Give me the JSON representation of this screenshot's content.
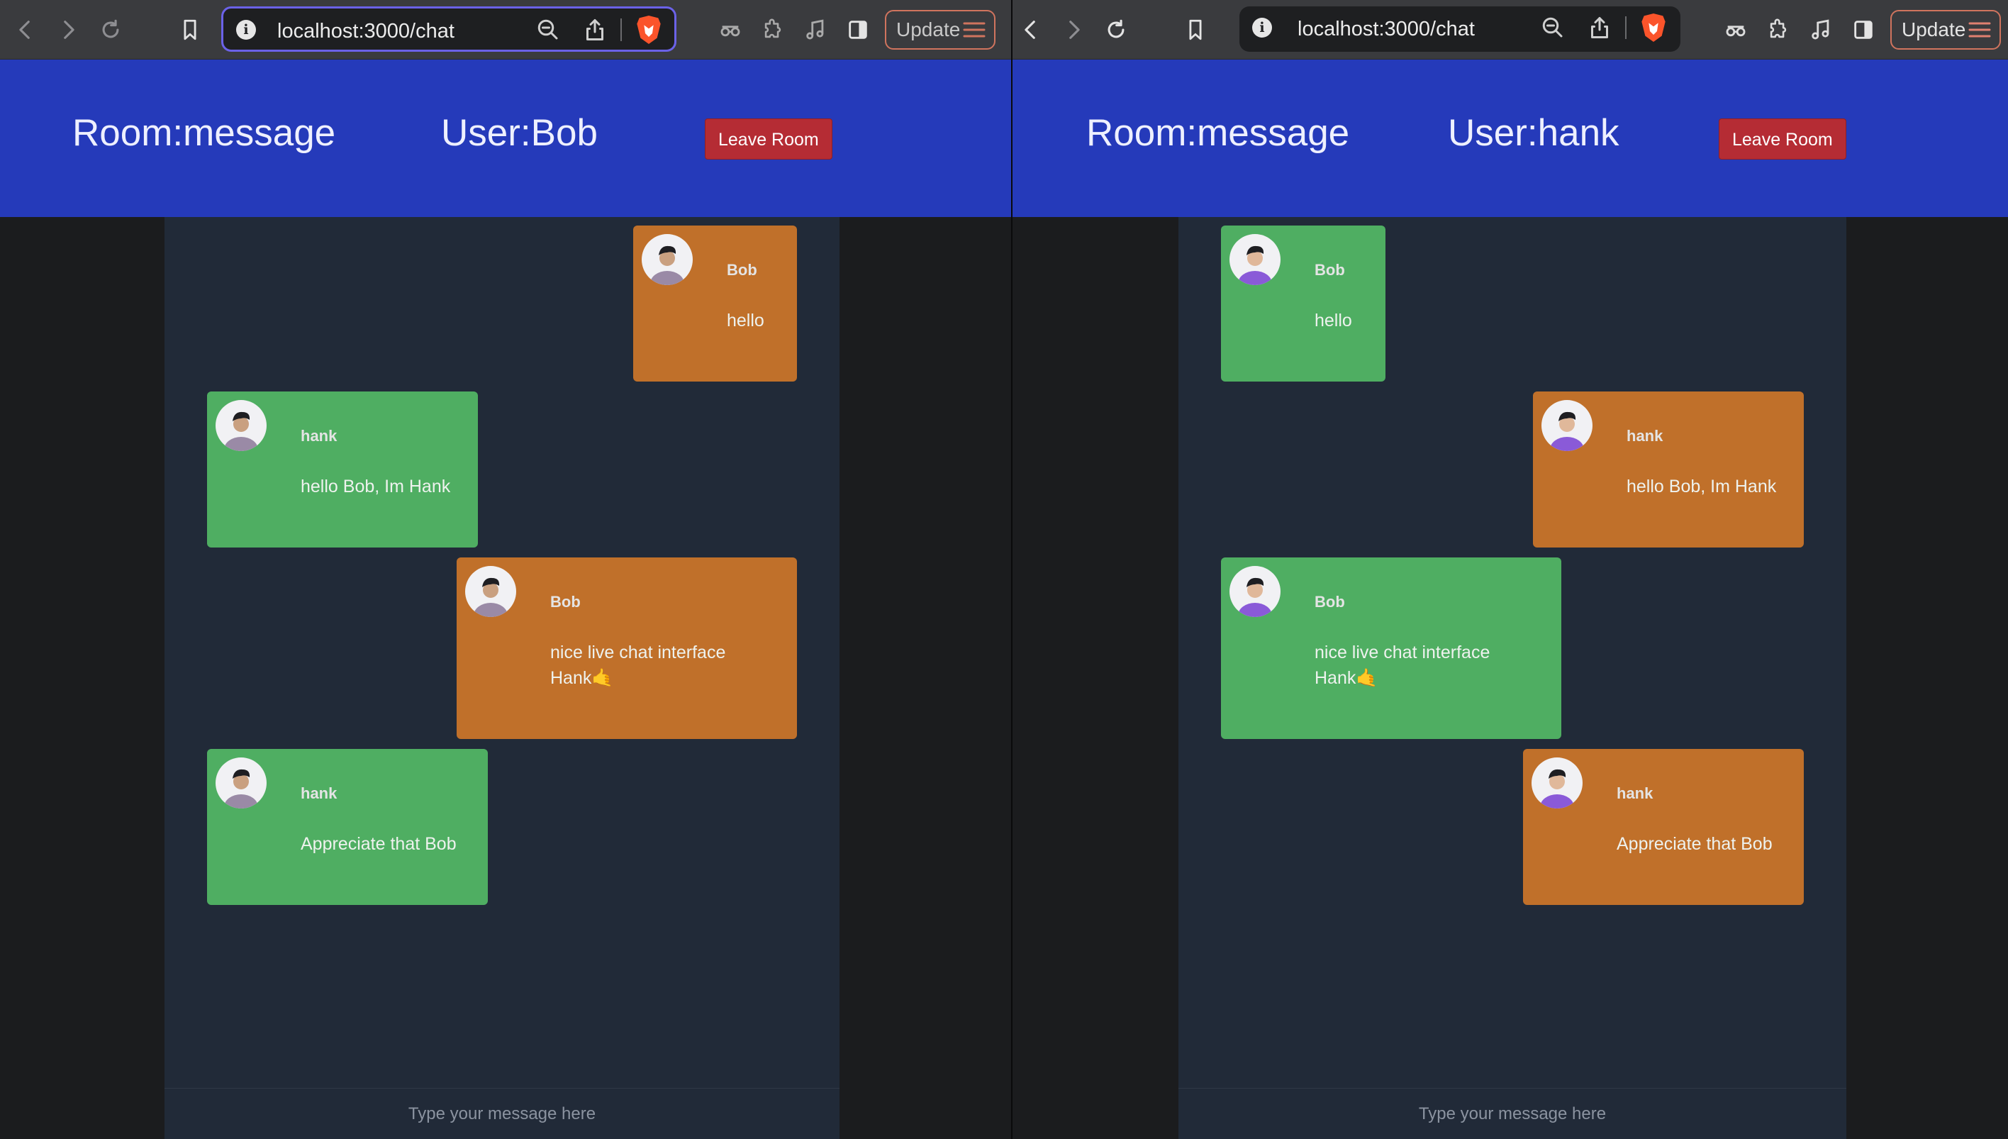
{
  "windows": [
    {
      "id": "left",
      "url": "localhost:3000/chat",
      "update_label": "Update",
      "room_label": "Room:message",
      "user_label": "User:Bob",
      "leave_label": "Leave Room",
      "input_placeholder": "Type your message here",
      "messages": [
        {
          "name": "Bob",
          "lines": [
            "hello"
          ],
          "color": "orange"
        },
        {
          "name": "hank",
          "lines": [
            "hello Bob, Im Hank"
          ],
          "color": "green"
        },
        {
          "name": "Bob",
          "lines": [
            "nice live chat interface",
            "Hank🤙"
          ],
          "color": "orange"
        },
        {
          "name": "hank",
          "lines": [
            "Appreciate that Bob"
          ],
          "color": "green"
        }
      ]
    },
    {
      "id": "right",
      "url": "localhost:3000/chat",
      "update_label": "Update",
      "room_label": "Room:message",
      "user_label": "User:hank",
      "leave_label": "Leave Room",
      "input_placeholder": "Type your message here",
      "messages": [
        {
          "name": "Bob",
          "lines": [
            "hello"
          ],
          "color": "green"
        },
        {
          "name": "hank",
          "lines": [
            "hello Bob, Im Hank"
          ],
          "color": "orange"
        },
        {
          "name": "Bob",
          "lines": [
            "nice live chat interface",
            "Hank🤙"
          ],
          "color": "green"
        },
        {
          "name": "hank",
          "lines": [
            "Appreciate that Bob"
          ],
          "color": "orange"
        }
      ]
    }
  ],
  "colors": {
    "header": "#253aba",
    "own_bubble": "#c0702a",
    "other_bubble": "#4fae62",
    "leave_button": "#b52c34",
    "chat_bg": "#212a38"
  },
  "icons": [
    "back-icon",
    "forward-icon",
    "reload-icon",
    "bookmark-icon",
    "site-info-icon",
    "zoom-out-icon",
    "share-icon",
    "brave-shield-icon",
    "incognito-glasses-icon",
    "extensions-icon",
    "media-icon",
    "sidebar-icon",
    "menu-icon"
  ]
}
